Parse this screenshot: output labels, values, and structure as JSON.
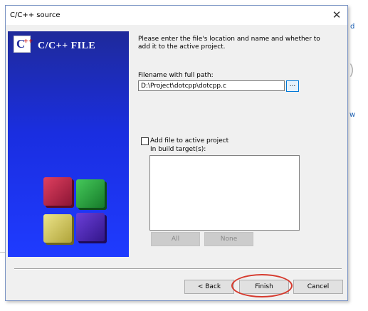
{
  "dialog": {
    "title": "C/C++ source",
    "close_glyph": "✕"
  },
  "banner": {
    "logo_letter": "C",
    "logo_plus": "++",
    "title": "C/C++ FILE"
  },
  "content": {
    "description": "Please enter the file's location and name and whether to add it to the active project.",
    "filename_label": "Filename with full path:",
    "filename_value": "D:\\Project\\dotcpp\\dotcpp.c",
    "browse_label": "...",
    "add_to_project_label": "Add file to active project",
    "add_to_project_checked": false,
    "build_targets_label": "In build target(s):",
    "build_targets": [],
    "all_button": "All",
    "none_button": "None"
  },
  "footer": {
    "back_button": "< Back",
    "finish_button": "Finish",
    "cancel_button": "Cancel"
  },
  "annotation": {
    "highlight_color": "#d63a2e",
    "highlighted": "finish-button"
  },
  "background": {
    "link_glyph_1": "d",
    "link_glyph_2": "w",
    "paren_glyph": ")"
  },
  "colors": {
    "banner_blue": "#1a2ee0",
    "dialog_bg": "#f0f0f0"
  }
}
